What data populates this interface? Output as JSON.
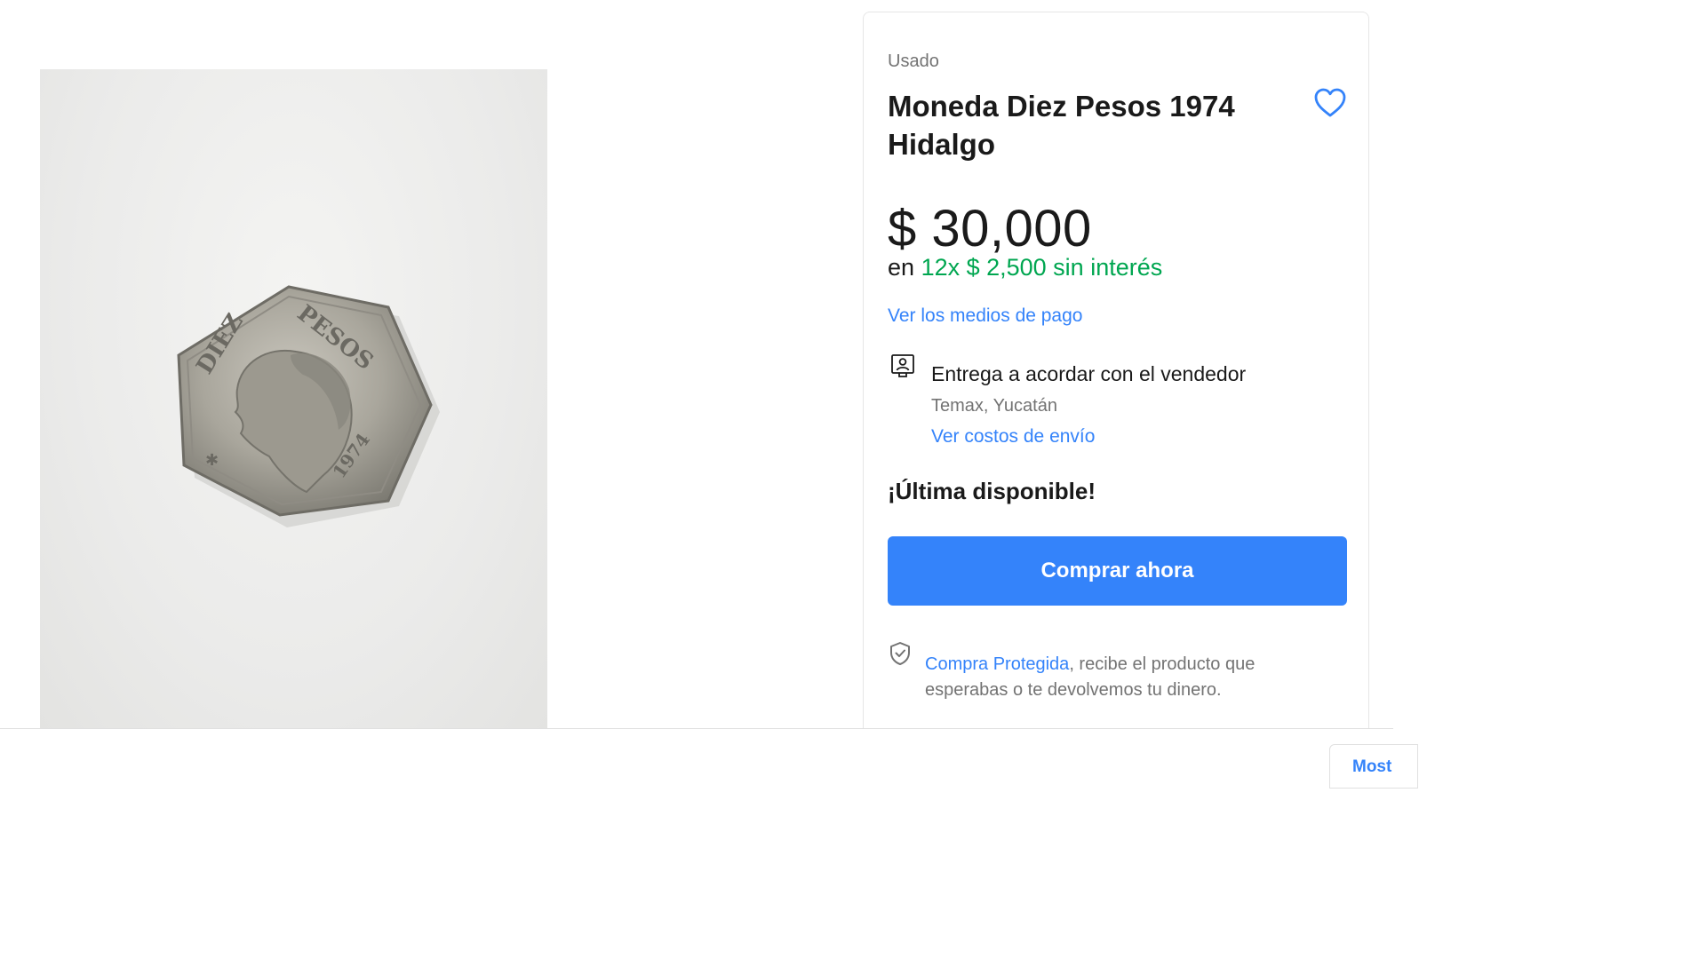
{
  "product": {
    "condition": "Usado",
    "title": "Moneda Diez Pesos 1974 Hidalgo",
    "price": "$ 30,000",
    "installments_prefix": "en",
    "installments_detail": "12x $ 2,500 sin interés",
    "payment_link": "Ver los medios de pago"
  },
  "photo": {
    "coin_top_text": "DIEZ PESOS",
    "coin_year": "1974"
  },
  "delivery": {
    "icon": "person-card-icon",
    "title": "Entrega a acordar con el vendedor",
    "location": "Temax, Yucatán",
    "shipping_link": "Ver costos de envío"
  },
  "stock": {
    "label": "¡Última disponible!"
  },
  "actions": {
    "buy_label": "Comprar ahora",
    "favorite_icon": "heart-icon"
  },
  "protection": {
    "icon": "shield-check-icon",
    "link": "Compra Protegida",
    "text": ", recibe el producto que esperabas o te devolvemos tu dinero."
  },
  "bottom": {
    "more_label": "Most"
  },
  "colors": {
    "accent": "#3483fa",
    "green": "#00a650",
    "muted": "#737373"
  }
}
